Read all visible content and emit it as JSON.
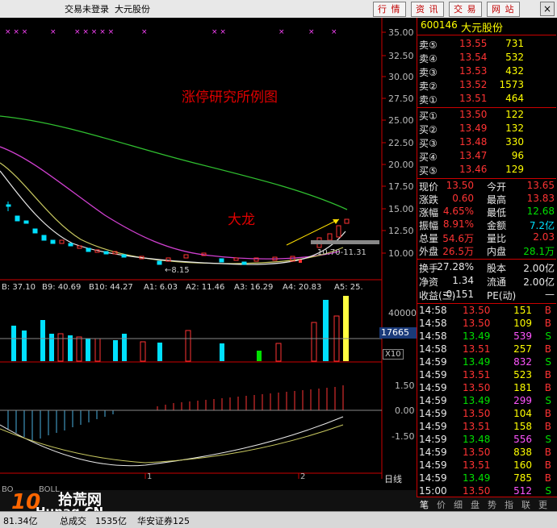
{
  "window": {
    "title": "交易未登录  大元股份",
    "buttons": [
      "行 情",
      "资 讯",
      "交 易",
      "网 站"
    ],
    "close": "×"
  },
  "chart": {
    "price_ticks": [
      "35.00",
      "32.50",
      "30.00",
      "27.50",
      "25.00",
      "22.50",
      "20.00",
      "17.50",
      "15.00",
      "12.50",
      "10.00"
    ],
    "annotation_title": "涨停研究所例图",
    "annotation_label": "大龙",
    "low_label": "←8.15",
    "range_label": "10.70-11.31",
    "volume_indicators": [
      "B: 37.10",
      "B9: 40.69",
      "B10: 44.27",
      "A1: 6.03",
      "A2: 11.46",
      "A3: 16.29",
      "A4: 20.83",
      "A5: 25."
    ],
    "volume_ticks": [
      "40000",
      "20000"
    ],
    "volume_current": "17665",
    "volume_unit": "X10",
    "macd_ticks": [
      "1.50",
      "0.00",
      "-1.50"
    ],
    "x_labels": [
      "1",
      "2"
    ],
    "period": "日线",
    "bottom_labels": [
      "BO",
      "BOLL"
    ],
    "colors": {
      "accent_red": "#c00000",
      "up": "#ff3333",
      "down": "#00e0ff",
      "ma_green": "#30c030",
      "ma_magenta": "#d040d0"
    }
  },
  "quote": {
    "code": "600146",
    "name": "大元股份",
    "asks": [
      {
        "label": "卖⑤",
        "price": "13.55",
        "vol": "731"
      },
      {
        "label": "卖④",
        "price": "13.54",
        "vol": "532"
      },
      {
        "label": "卖③",
        "price": "13.53",
        "vol": "432"
      },
      {
        "label": "卖②",
        "price": "13.52",
        "vol": "1573"
      },
      {
        "label": "卖①",
        "price": "13.51",
        "vol": "464"
      }
    ],
    "bids": [
      {
        "label": "买①",
        "price": "13.50",
        "vol": "122"
      },
      {
        "label": "买②",
        "price": "13.49",
        "vol": "132"
      },
      {
        "label": "买③",
        "price": "13.48",
        "vol": "330"
      },
      {
        "label": "买④",
        "price": "13.47",
        "vol": "96"
      },
      {
        "label": "买⑤",
        "price": "13.46",
        "vol": "129"
      }
    ],
    "stats": [
      {
        "l1": "现价",
        "v1": "13.50",
        "l2": "今开",
        "v2": "13.65"
      },
      {
        "l1": "涨跌",
        "v1": "0.60",
        "l2": "最高",
        "v2": "13.83"
      },
      {
        "l1": "涨幅",
        "v1": "4.65%",
        "l2": "最低",
        "v2": "12.68"
      },
      {
        "l1": "振幅",
        "v1": "8.91%",
        "l2": "金额",
        "v2": "7.2亿"
      },
      {
        "l1": "总量",
        "v1": "54.6万",
        "l2": "量比",
        "v2": "2.03"
      },
      {
        "l1": "外盘",
        "v1": "26.5万",
        "l2": "内盘",
        "v2": "28.1万"
      }
    ],
    "stats2": [
      {
        "l1": "换手",
        "v1": "27.28%",
        "l2": "股本",
        "v2": "2.00亿"
      },
      {
        "l1": "净资",
        "v1": "1.34",
        "l2": "流通",
        "v2": "2.00亿"
      },
      {
        "l1": "收益(三)",
        "v1": "-0.151",
        "l2": "PE(动)",
        "v2": "—"
      }
    ],
    "ticks": [
      {
        "t": "14:58",
        "p": "13.50",
        "v": "151",
        "d": "B"
      },
      {
        "t": "14:58",
        "p": "13.50",
        "v": "109",
        "d": "B"
      },
      {
        "t": "14:58",
        "p": "13.49",
        "v": "539",
        "d": "S"
      },
      {
        "t": "14:58",
        "p": "13.51",
        "v": "257",
        "d": "B"
      },
      {
        "t": "14:59",
        "p": "13.49",
        "v": "832",
        "d": "S"
      },
      {
        "t": "14:59",
        "p": "13.51",
        "v": "523",
        "d": "B"
      },
      {
        "t": "14:59",
        "p": "13.50",
        "v": "181",
        "d": "B"
      },
      {
        "t": "14:59",
        "p": "13.49",
        "v": "299",
        "d": "S"
      },
      {
        "t": "14:59",
        "p": "13.50",
        "v": "104",
        "d": "B"
      },
      {
        "t": "14:59",
        "p": "13.51",
        "v": "158",
        "d": "B"
      },
      {
        "t": "14:59",
        "p": "13.48",
        "v": "556",
        "d": "S"
      },
      {
        "t": "14:59",
        "p": "13.50",
        "v": "838",
        "d": "B"
      },
      {
        "t": "14:59",
        "p": "13.51",
        "v": "160",
        "d": "B"
      },
      {
        "t": "14:59",
        "p": "13.49",
        "v": "785",
        "d": "B"
      },
      {
        "t": "15:00",
        "p": "13.50",
        "v": "512",
        "d": "S"
      }
    ],
    "tabs": [
      "笔",
      "价",
      "细",
      "盘",
      "势",
      "指",
      "联",
      "更"
    ]
  },
  "status": {
    "index_value": "81.34亿",
    "total_label": "总成交",
    "total_value": "1535亿",
    "broker": "华安证券125",
    "watermark": "拾荒网",
    "watermark_url": "Hunag.CN"
  }
}
